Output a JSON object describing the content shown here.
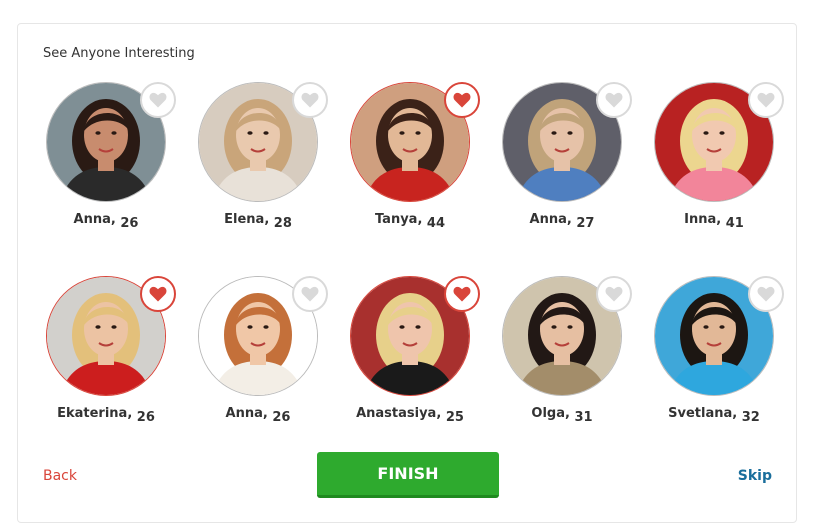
{
  "heading": "See Anyone Interesting",
  "profiles": [
    {
      "name": "Anna",
      "age": "26",
      "liked": false,
      "skin": "#c88c6e",
      "hair": "#2a1a14",
      "bg": "#7f8f95",
      "shirt": "#2a2a2a"
    },
    {
      "name": "Elena",
      "age": "28",
      "liked": false,
      "skin": "#e9c9ae",
      "hair": "#c9a57a",
      "bg": "#d7ccbf",
      "shirt": "#e8e1d8"
    },
    {
      "name": "Tanya",
      "age": "44",
      "liked": true,
      "skin": "#e2b896",
      "hair": "#3b2218",
      "bg": "#cf9f7f",
      "shirt": "#c8241f"
    },
    {
      "name": "Anna",
      "age": "27",
      "liked": false,
      "skin": "#e6c2a8",
      "hair": "#c0a37a",
      "bg": "#5f5f69",
      "shirt": "#4f7fc0"
    },
    {
      "name": "Inna",
      "age": "41",
      "liked": false,
      "skin": "#f1c9b0",
      "hair": "#ecd68f",
      "bg": "#b82222",
      "shirt": "#f2859a"
    },
    {
      "name": "Ekaterina",
      "age": "26",
      "liked": true,
      "skin": "#ecc3a3",
      "hair": "#e3c07b",
      "bg": "#d2d0cc",
      "shirt": "#cc1e1e"
    },
    {
      "name": "Anna",
      "age": "26",
      "liked": false,
      "skin": "#f0c7a7",
      "hair": "#c4703a",
      "bg": "#ffffff",
      "shirt": "#f3eee6"
    },
    {
      "name": "Anastasiya",
      "age": "25",
      "liked": true,
      "skin": "#efc5ac",
      "hair": "#e7d08a",
      "bg": "#a8302e",
      "shirt": "#1a1a1a"
    },
    {
      "name": "Olga",
      "age": "31",
      "liked": false,
      "skin": "#e6bfa2",
      "hair": "#221815",
      "bg": "#cfc4ad",
      "shirt": "#a38d6a"
    },
    {
      "name": "Svetlana",
      "age": "32",
      "liked": false,
      "skin": "#e2b897",
      "hair": "#1c1612",
      "bg": "#3fa7d9",
      "shirt": "#2ea7de"
    }
  ],
  "back_label": "Back",
  "finish_label": "FINISH",
  "skip_label": "Skip",
  "colors": {
    "like_active": "#d9453a",
    "like_inactive": "#d9d9d9",
    "finish_bg": "#2eaa2e",
    "back": "#d9453a",
    "skip": "#1a6e9c"
  }
}
